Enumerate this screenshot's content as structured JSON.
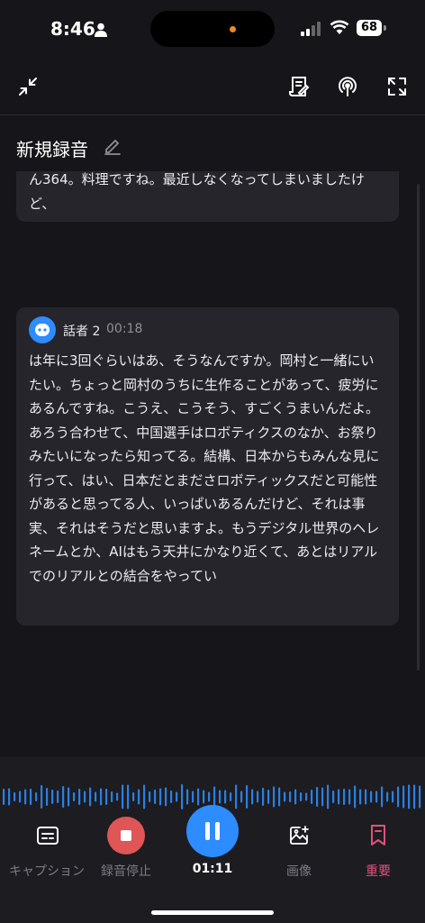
{
  "status_bar": {
    "time": "8:46",
    "battery": "68"
  },
  "toolbar": {
    "minimize_icon": "collapse-arrows-icon",
    "transcript_icon": "document-edit-icon",
    "podcast_icon": "podcast-icon",
    "expand_icon": "expand-icon"
  },
  "header": {
    "title": "新規録音"
  },
  "transcript": {
    "segments": [
      {
        "text": "ん364。料理ですね。最近しなくなってしまいましたけど、"
      },
      {
        "speaker": "話者 2",
        "time": "00:18",
        "text": "は年に3回ぐらいはあ、そうなんですか。岡村と一緒にいたい。ちょっと岡村のうちに生作ることがあって、疲労にあるんですね。こうえ、こうそう、すごくうまいんだよ。あろう合わせて、中国選手はロボティクスのなか、お祭りみたいになったら知ってる。結構、日本からもみんな見に行って、はい、日本だとまださロボティックスだと可能性があると思ってる人、いっぱいあるんだけど、それは事実、それはそうだと思いますよ。もうデジタル世界のヘレネームとか、AIはもう天井にかなり近くて、あとはリアルでのリアルとの結合をやってい"
      }
    ]
  },
  "controls": {
    "caption": "キャプション",
    "stop": "録音停止",
    "elapsed": "01:11",
    "image": "画像",
    "important": "重要"
  },
  "colors": {
    "accent": "#2d8cff",
    "stop": "#e05555",
    "important": "#e0527a",
    "card": "#25252b"
  }
}
